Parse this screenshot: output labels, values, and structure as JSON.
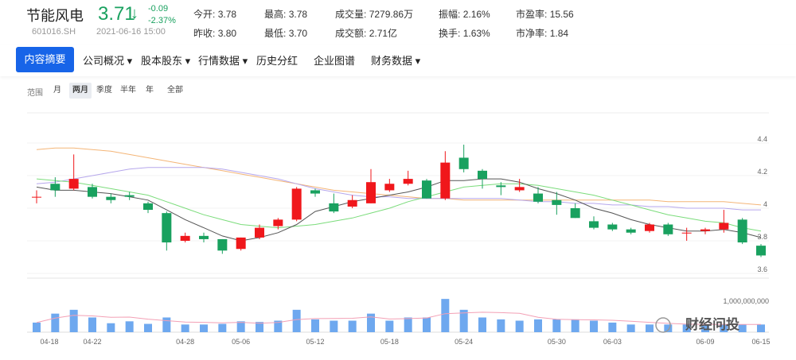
{
  "stock": {
    "name": "节能风电",
    "code": "601016.SH",
    "price": "3.71",
    "arrow": "↓",
    "change": "-0.09",
    "change_pct": "-2.37%",
    "datetime": "2021-06-16 15:00",
    "color_down": "#19a15f",
    "color_up": "#f0171b"
  },
  "quote": {
    "open_label": "今开:",
    "open": "3.78",
    "high_label": "最高:",
    "high": "3.78",
    "volume_label": "成交量:",
    "volume": "7279.86万",
    "amplitude_label": "振幅:",
    "amplitude": "2.16%",
    "pe_label": "市盈率:",
    "pe": "15.56",
    "prev_close_label": "昨收:",
    "prev_close": "3.80",
    "low_label": "最低:",
    "low": "3.70",
    "amount_label": "成交额:",
    "amount": "2.71亿",
    "turnover_label": "换手:",
    "turnover": "1.63%",
    "pb_label": "市净率:",
    "pb": "1.84"
  },
  "nav": {
    "items": [
      "内容摘要",
      "公司概况 ▾",
      "股本股东 ▾",
      "行情数据 ▾",
      "历史分红",
      "企业图谱",
      "财务数据 ▾"
    ]
  },
  "range": {
    "label": "范围",
    "options": [
      "月",
      "两月",
      "季度",
      "半年",
      "年",
      "全部"
    ],
    "active": "两月"
  },
  "watermark": "财经问投",
  "chart_data": {
    "type": "candlestick",
    "y_ticks": [
      "4.4",
      "4.2",
      "4",
      "3.8",
      "3.6"
    ],
    "ylim": [
      3.6,
      4.4
    ],
    "volume_label": "1,000,000,000",
    "x_tick_labels": [
      "04-18",
      "04-22",
      "04-28",
      "05-06",
      "05-12",
      "05-18",
      "05-24",
      "05-30",
      "06-03",
      "06-09",
      "06-15"
    ],
    "candles": [
      {
        "o": 4.07,
        "c": 4.07,
        "h": 4.11,
        "l": 4.03
      },
      {
        "o": 4.15,
        "c": 4.11,
        "h": 4.19,
        "l": 4.07
      },
      {
        "o": 4.12,
        "c": 4.18,
        "h": 4.33,
        "l": 4.11
      },
      {
        "o": 4.13,
        "c": 4.07,
        "h": 4.15,
        "l": 4.06
      },
      {
        "o": 4.07,
        "c": 4.05,
        "h": 4.09,
        "l": 4.03
      },
      {
        "o": 4.08,
        "c": 4.07,
        "h": 4.1,
        "l": 4.05
      },
      {
        "o": 4.03,
        "c": 3.99,
        "h": 4.04,
        "l": 3.97
      },
      {
        "o": 3.97,
        "c": 3.79,
        "h": 3.98,
        "l": 3.74
      },
      {
        "o": 3.8,
        "c": 3.83,
        "h": 3.85,
        "l": 3.79
      },
      {
        "o": 3.83,
        "c": 3.81,
        "h": 3.85,
        "l": 3.79
      },
      {
        "o": 3.81,
        "c": 3.74,
        "h": 3.81,
        "l": 3.72
      },
      {
        "o": 3.75,
        "c": 3.82,
        "h": 3.82,
        "l": 3.74
      },
      {
        "o": 3.82,
        "c": 3.88,
        "h": 3.9,
        "l": 3.81
      },
      {
        "o": 3.89,
        "c": 3.93,
        "h": 3.94,
        "l": 3.87
      },
      {
        "o": 3.93,
        "c": 4.12,
        "h": 4.13,
        "l": 3.92
      },
      {
        "o": 4.11,
        "c": 4.09,
        "h": 4.12,
        "l": 4.07
      },
      {
        "o": 4.03,
        "c": 3.98,
        "h": 4.09,
        "l": 3.97
      },
      {
        "o": 4.01,
        "c": 4.05,
        "h": 4.08,
        "l": 4.0
      },
      {
        "o": 4.03,
        "c": 4.16,
        "h": 4.24,
        "l": 4.03
      },
      {
        "o": 4.11,
        "c": 4.15,
        "h": 4.18,
        "l": 4.1
      },
      {
        "o": 4.15,
        "c": 4.18,
        "h": 4.23,
        "l": 4.14
      },
      {
        "o": 4.17,
        "c": 4.06,
        "h": 4.18,
        "l": 4.06
      },
      {
        "o": 4.06,
        "c": 4.28,
        "h": 4.35,
        "l": 4.05
      },
      {
        "o": 4.31,
        "c": 4.24,
        "h": 4.39,
        "l": 4.22
      },
      {
        "o": 4.23,
        "c": 4.18,
        "h": 4.24,
        "l": 4.12
      },
      {
        "o": 4.14,
        "c": 4.13,
        "h": 4.16,
        "l": 4.08
      },
      {
        "o": 4.11,
        "c": 4.13,
        "h": 4.18,
        "l": 4.1
      },
      {
        "o": 4.09,
        "c": 4.04,
        "h": 4.13,
        "l": 4.03
      },
      {
        "o": 4.05,
        "c": 4.02,
        "h": 4.1,
        "l": 3.96
      },
      {
        "o": 4.0,
        "c": 3.94,
        "h": 4.03,
        "l": 3.94
      },
      {
        "o": 3.92,
        "c": 3.88,
        "h": 3.95,
        "l": 3.87
      },
      {
        "o": 3.9,
        "c": 3.87,
        "h": 3.91,
        "l": 3.86
      },
      {
        "o": 3.87,
        "c": 3.85,
        "h": 3.88,
        "l": 3.84
      },
      {
        "o": 3.86,
        "c": 3.9,
        "h": 3.91,
        "l": 3.85
      },
      {
        "o": 3.9,
        "c": 3.84,
        "h": 3.91,
        "l": 3.83
      },
      {
        "o": 3.85,
        "c": 3.85,
        "h": 3.88,
        "l": 3.8
      },
      {
        "o": 3.86,
        "c": 3.87,
        "h": 3.88,
        "l": 3.84
      },
      {
        "o": 3.87,
        "c": 3.91,
        "h": 3.99,
        "l": 3.85
      },
      {
        "o": 3.93,
        "c": 3.79,
        "h": 3.94,
        "l": 3.78
      },
      {
        "o": 3.77,
        "c": 3.71,
        "h": 3.78,
        "l": 3.7
      }
    ],
    "volumes": [
      30,
      58,
      70,
      46,
      28,
      34,
      26,
      46,
      24,
      24,
      26,
      34,
      32,
      36,
      70,
      40,
      36,
      36,
      58,
      36,
      46,
      46,
      104,
      70,
      46,
      40,
      36,
      40,
      40,
      40,
      36,
      30,
      24,
      24,
      24,
      24,
      24,
      24,
      24,
      24
    ],
    "volume_max": 120,
    "ma5": [
      4.13,
      4.11,
      4.11,
      4.1,
      4.09,
      4.07,
      4.05,
      3.99,
      3.93,
      3.88,
      3.83,
      3.8,
      3.82,
      3.85,
      3.9,
      3.98,
      4.01,
      4.04,
      4.06,
      4.08,
      4.1,
      4.13,
      4.17,
      4.17,
      4.18,
      4.18,
      4.16,
      4.12,
      4.09,
      4.05,
      4.0,
      3.97,
      3.93,
      3.9,
      3.88,
      3.86,
      3.86,
      3.87,
      3.85,
      3.82
    ],
    "ma10": [
      4.18,
      4.17,
      4.16,
      4.14,
      4.12,
      4.1,
      4.08,
      4.04,
      4.0,
      3.96,
      3.93,
      3.9,
      3.89,
      3.88,
      3.89,
      3.9,
      3.92,
      3.94,
      3.97,
      4.0,
      4.04,
      4.07,
      4.1,
      4.13,
      4.14,
      4.15,
      4.15,
      4.14,
      4.12,
      4.1,
      4.08,
      4.05,
      4.02,
      3.99,
      3.96,
      3.94,
      3.92,
      3.91,
      3.88,
      3.86
    ],
    "ma20": [
      4.15,
      4.16,
      4.18,
      4.2,
      4.22,
      4.24,
      4.25,
      4.25,
      4.25,
      4.25,
      4.24,
      4.22,
      4.2,
      4.18,
      4.15,
      4.12,
      4.1,
      4.08,
      4.07,
      4.07,
      4.06,
      4.06,
      4.06,
      4.06,
      4.06,
      4.06,
      4.05,
      4.04,
      4.04,
      4.03,
      4.03,
      4.02,
      4.02,
      4.01,
      4.01,
      4.0,
      4.0,
      4.0,
      3.99,
      3.99
    ],
    "ma60": [
      4.36,
      4.37,
      4.37,
      4.36,
      4.35,
      4.33,
      4.31,
      4.29,
      4.27,
      4.25,
      4.23,
      4.21,
      4.19,
      4.17,
      4.15,
      4.13,
      4.11,
      4.1,
      4.09,
      4.08,
      4.07,
      4.06,
      4.06,
      4.05,
      4.05,
      4.05,
      4.05,
      4.05,
      4.05,
      4.05,
      4.05,
      4.05,
      4.05,
      4.05,
      4.04,
      4.04,
      4.04,
      4.04,
      4.03,
      4.02
    ],
    "ma_colors": {
      "ma5": "#555555",
      "ma10": "#7bdc7b",
      "ma20": "#b6a7ec",
      "ma60": "#f4b577"
    }
  }
}
